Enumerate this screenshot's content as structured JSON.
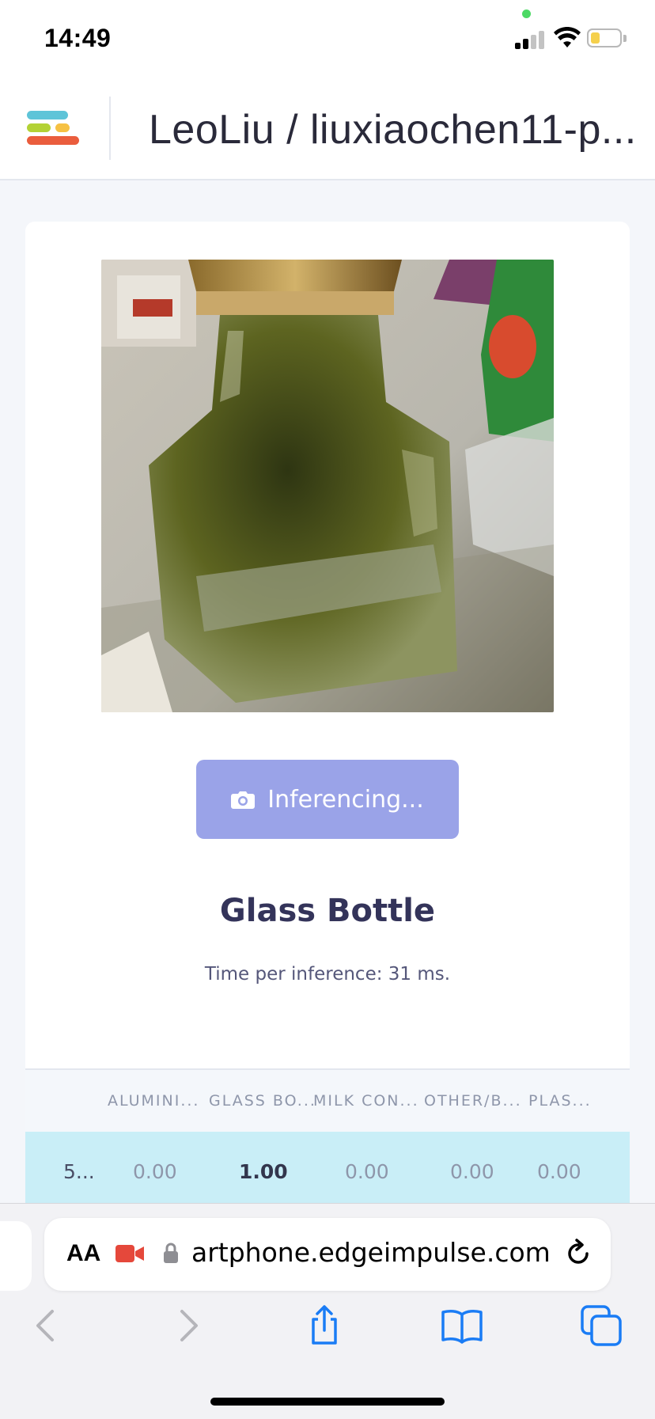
{
  "status_bar": {
    "time": "14:49",
    "icons": [
      "privacy-dot",
      "cellular-signal-icon",
      "wifi-icon",
      "battery-icon"
    ]
  },
  "header": {
    "project_title": "LeoLiu / liuxiaochen11-p...",
    "logo_icon": "edge-impulse-logo"
  },
  "main": {
    "image_description_icon": "camera-preview",
    "button_label": "Inferencing...",
    "button_icon": "camera-icon",
    "result_label": "Glass Bottle",
    "timing_text": "Time per inference: 31 ms."
  },
  "table": {
    "headers": [
      "ALUMINI...",
      "GLASS BO...",
      "MILK CON...",
      "OTHER/B...",
      "PLAS..."
    ],
    "row": [
      "5...",
      "0.00",
      "1.00",
      "0.00",
      "0.00",
      "0.00"
    ]
  },
  "browser": {
    "text_size_label": "AA",
    "url": "artphone.edgeimpulse.com",
    "nav_icons": [
      "back-icon",
      "forward-icon",
      "share-icon",
      "bookmarks-icon",
      "tabs-icon"
    ]
  },
  "colors": {
    "button": "#9aa3e8",
    "row_highlight": "#c9eef7",
    "title": "#34345a"
  }
}
